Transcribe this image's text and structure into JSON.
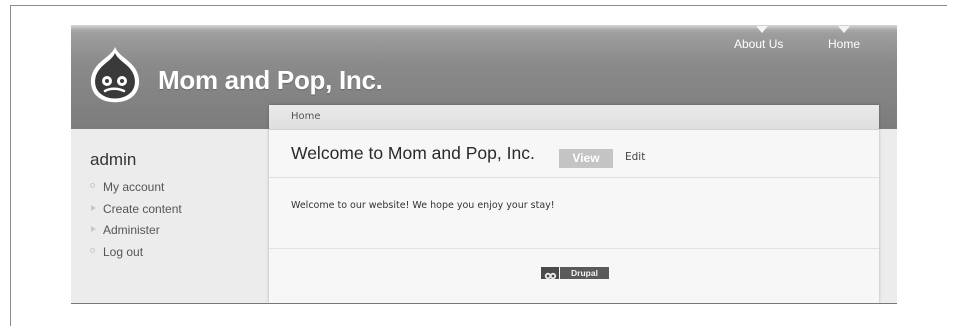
{
  "site": {
    "name": "Mom and Pop, Inc.",
    "primary_links": [
      "About Us",
      "Home"
    ]
  },
  "sidebar": {
    "title": "admin",
    "items": [
      {
        "label": "My account",
        "bullet": "circle"
      },
      {
        "label": "Create content",
        "bullet": "triangle"
      },
      {
        "label": "Administer",
        "bullet": "triangle"
      },
      {
        "label": "Log out",
        "bullet": "circle"
      }
    ]
  },
  "main": {
    "breadcrumb": "Home",
    "title": "Welcome to Mom and Pop, Inc.",
    "tabs": [
      {
        "label": "View",
        "active": true
      },
      {
        "label": "Edit",
        "active": false
      }
    ],
    "body": "Welcome to our website! We hope you enjoy your stay!"
  },
  "footer": {
    "badge_label": "Drupal"
  },
  "colors": {
    "header": "#8a8a8a",
    "active_tab": "#c4c4c4",
    "page_background": "#ececec"
  }
}
